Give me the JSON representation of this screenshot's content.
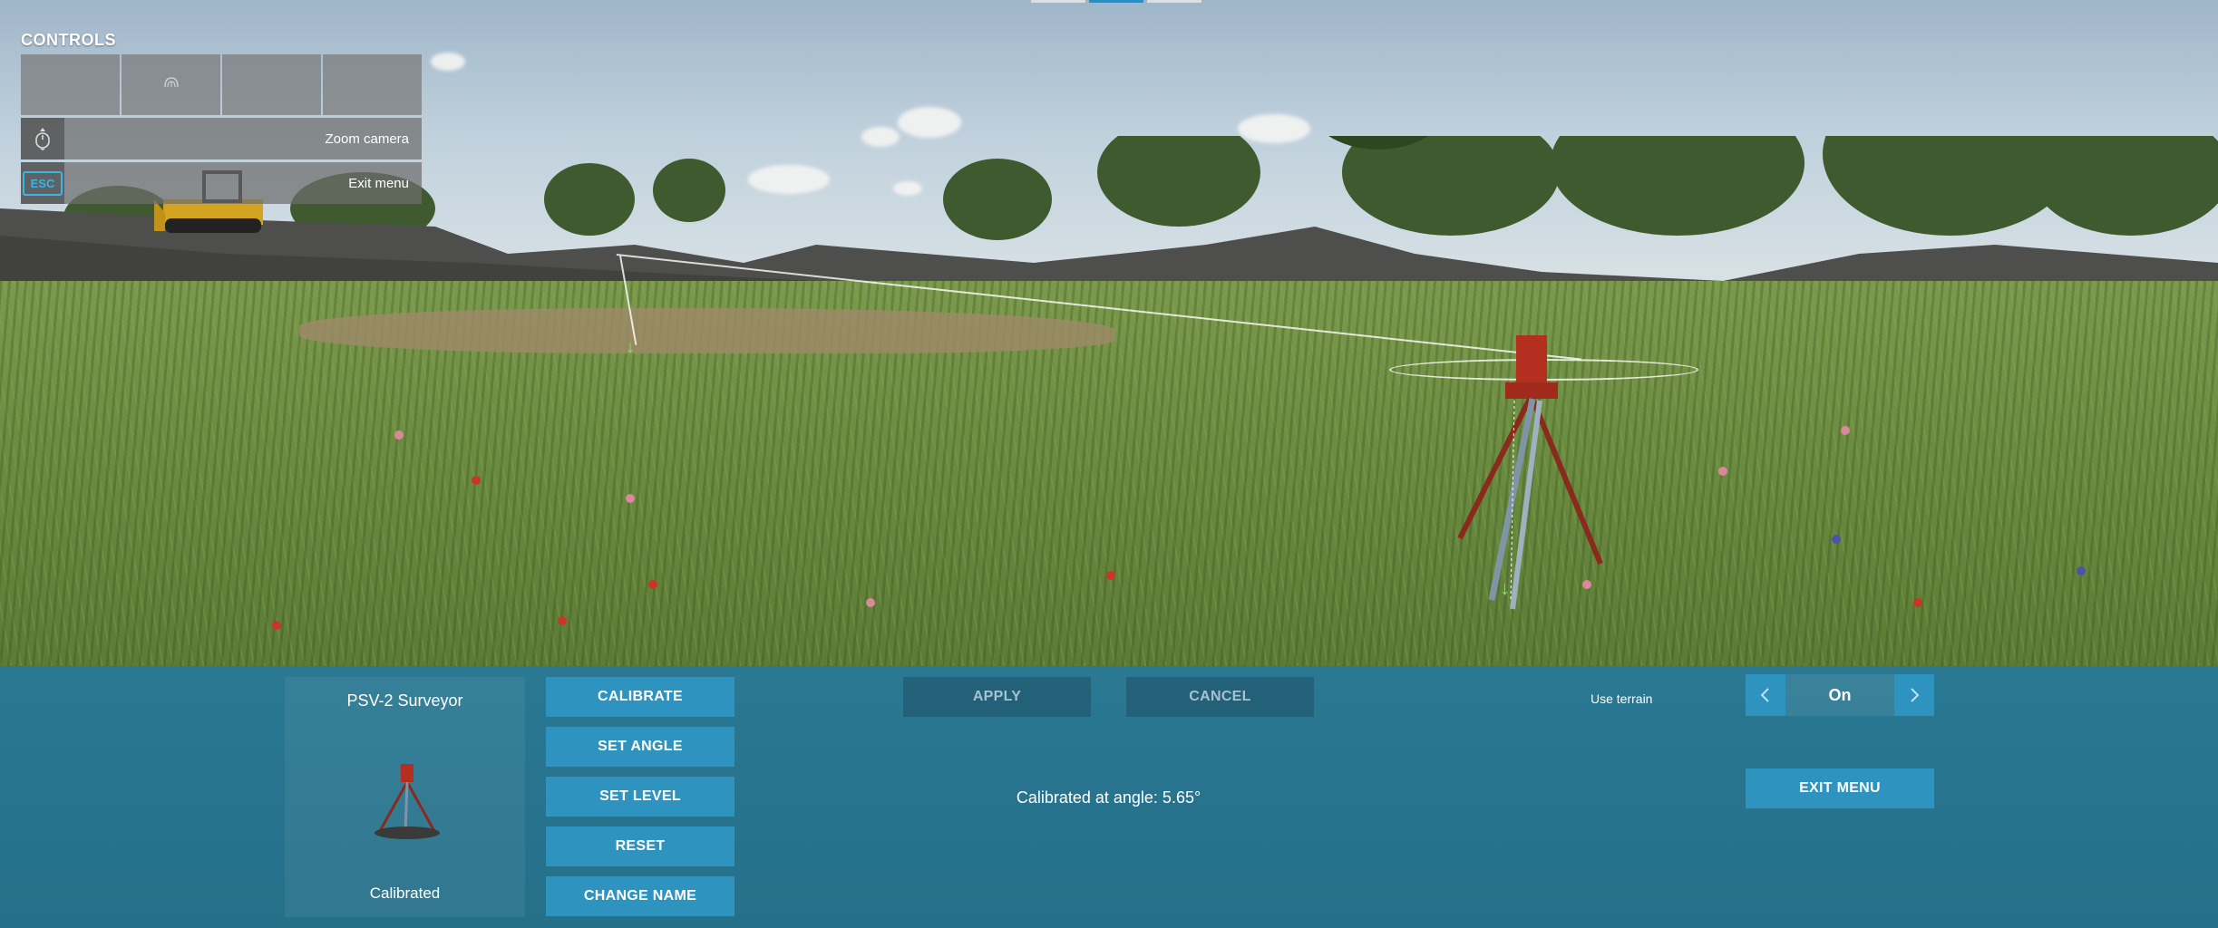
{
  "controls": {
    "title": "CONTROLS",
    "zoom_label": "Zoom camera",
    "exit_label": "Exit menu",
    "esc_key": "ESC"
  },
  "icons": {
    "mouse": "mouse-icon",
    "mouse_scroll": "mouse-scroll-icon",
    "escape": "escape-key-icon",
    "chevron_left": "chevron-left-icon",
    "chevron_right": "chevron-right-icon"
  },
  "device": {
    "name": "PSV-2 Surveyor",
    "status": "Calibrated"
  },
  "actions": {
    "calibrate": "CALIBRATE",
    "set_angle": "SET ANGLE",
    "set_level": "SET LEVEL",
    "reset": "RESET",
    "change_name": "CHANGE NAME",
    "apply": "APPLY",
    "cancel": "CANCEL",
    "exit_menu": "EXIT MENU"
  },
  "status_text": "Calibrated at angle: 5.65°",
  "terrain": {
    "label": "Use terrain",
    "value": "On"
  },
  "colors": {
    "panel": "#2a7893",
    "button": "#2f93bf",
    "accent": "#38b6e6"
  }
}
